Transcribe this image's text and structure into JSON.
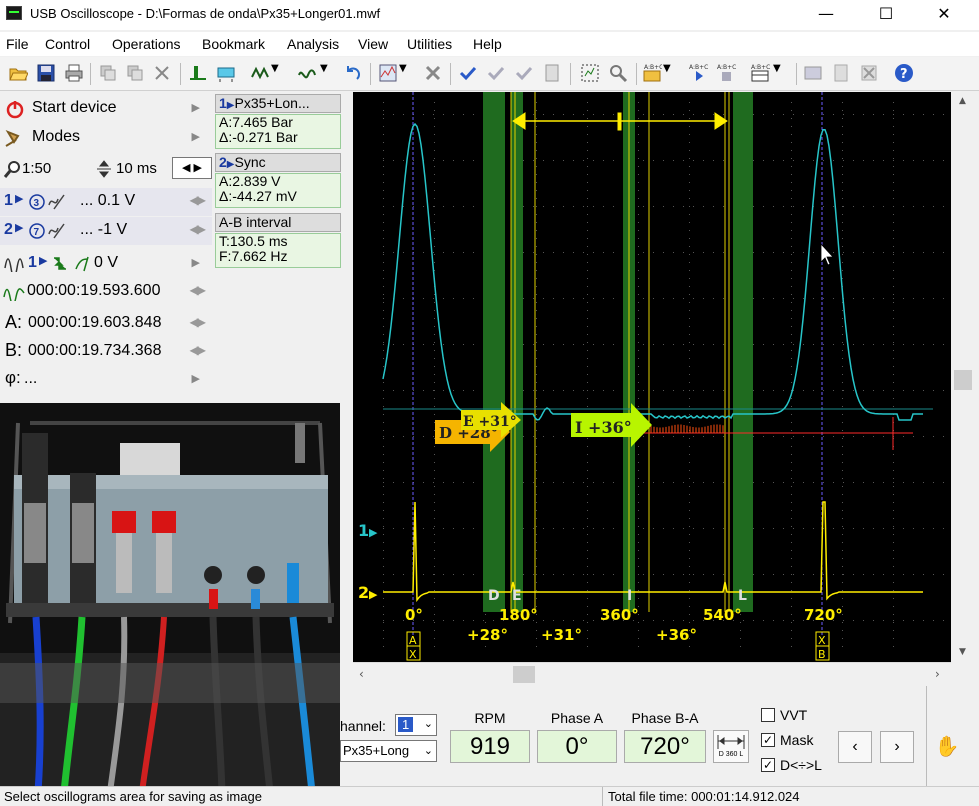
{
  "window": {
    "title": "USB Oscilloscope - D:\\Formas de onda\\Px35+Longer01.mwf",
    "minimize": "—",
    "maximize": "☐",
    "close": "✕"
  },
  "menu": [
    "File",
    "Control",
    "Operations",
    "Bookmark",
    "Analysis",
    "View",
    "Utilities",
    "Help"
  ],
  "left_panel": {
    "start_device": "Start device",
    "modes": "Modes",
    "zoom": "1:50",
    "timebase": "10 ms",
    "ch1_scale": "... 0.1 V",
    "ch2_scale": "... -1 V",
    "trigger_level": "0 V",
    "time_position": "000:00:19.593.600",
    "cursor_a_time": "000:00:19.603.848",
    "cursor_b_time": "000:00:19.734.368",
    "phi_value": "...",
    "label_a": "A:",
    "label_b": "B:",
    "label_phi": "φ:",
    "ch1_num": "1",
    "ch2_num": "2",
    "trig_ch": "1"
  },
  "info_panel": {
    "ch1_name": "Px35+Lon...",
    "ch1_a": "A:7.465 Bar",
    "ch1_delta": "Δ:-0.271 Bar",
    "ch2_name": "Sync",
    "ch2_a": "A:2.839 V",
    "ch2_delta": "Δ:-44.27 mV",
    "interval_title": "A-B interval",
    "interval_t": "T:130.5 ms",
    "interval_f": "F:7.662 Hz",
    "ch1_label": "1",
    "ch2_label": "2"
  },
  "scope": {
    "ch1_marker": "1",
    "ch2_marker": "2",
    "degree_labels": [
      "0°",
      "180°",
      "360°",
      "540°",
      "720°"
    ],
    "phase_offsets": [
      "+28°",
      "+31°",
      "+36°"
    ],
    "event_letters": [
      "D",
      "E",
      "I",
      "L"
    ],
    "arrow_d": "D +28°",
    "arrow_e": "E +31°",
    "arrow_i": "I +36°",
    "cursor_a": "A",
    "cursor_b": "B",
    "cursor_x": "X",
    "colors": {
      "ch1": "#27c5c9",
      "ch2": "#ffee00",
      "band": "#1f6b1f",
      "cursor": "#6b5cff",
      "grid": "#3a3a3a",
      "red_marker": "#ff2a2a"
    }
  },
  "bottom": {
    "channel_label": "hannel:",
    "channel_value": "1",
    "profile": "Px35+Long",
    "rpm_label": "RPM",
    "rpm_value": "919",
    "phase_a_label": "Phase A",
    "phase_a_value": "0°",
    "phase_ba_label": "Phase B-A",
    "phase_ba_value": "720°",
    "d360_label": "D 360 L",
    "vvt_label": "VVT",
    "vvt_checked": false,
    "mask_label": "Mask",
    "mask_checked": true,
    "dl_label": "D<÷>L",
    "dl_checked": true
  },
  "status": {
    "left": "Select oscillograms area for saving as image",
    "right": "Total file time: 000:01:14.912.024"
  }
}
